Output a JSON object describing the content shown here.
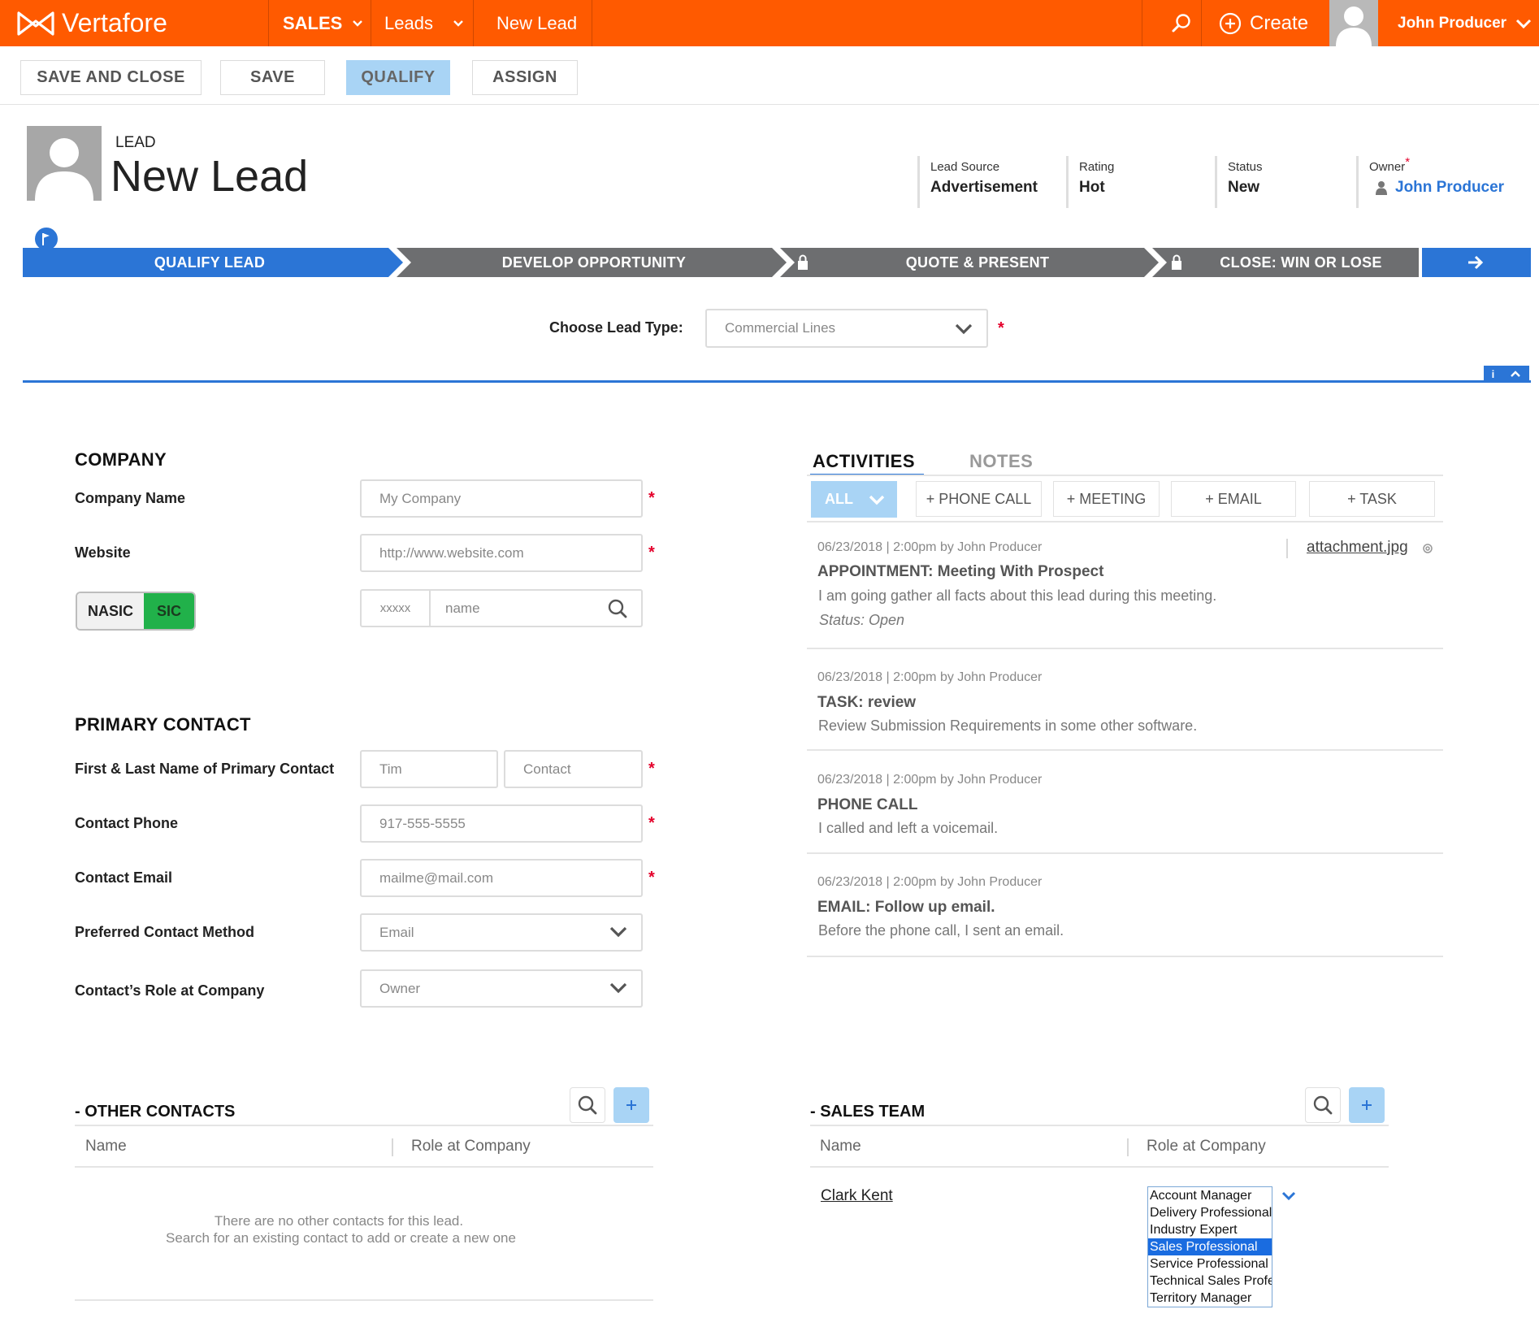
{
  "colors": {
    "brand": "#ff5a00",
    "accent": "#2b75d6",
    "required": "#e4002b",
    "sic_active": "#21b14a",
    "stage_inactive": "#6d6e70"
  },
  "topnav": {
    "brand": "Vertafore",
    "module": "SALES",
    "section": "Leads",
    "page": "New Lead",
    "create": "Create",
    "user": "John Producer"
  },
  "toolbar": {
    "save_close": "SAVE AND CLOSE",
    "save": "SAVE",
    "qualify": "QUALIFY",
    "assign": "ASSIGN"
  },
  "header": {
    "record_type": "LEAD",
    "title": "New Lead",
    "fields": {
      "lead_source": {
        "label": "Lead Source",
        "value": "Advertisement"
      },
      "rating": {
        "label": "Rating",
        "value": "Hot"
      },
      "status": {
        "label": "Status",
        "value": "New"
      },
      "owner": {
        "label": "Owner",
        "required": "*",
        "value": "John Producer"
      }
    }
  },
  "stages": [
    "QUALIFY LEAD",
    "DEVELOP OPPORTUNITY",
    "QUOTE & PRESENT",
    "CLOSE: WIN OR LOSE"
  ],
  "lead_type": {
    "label": "Choose Lead Type:",
    "value": "Commercial Lines",
    "required": "*"
  },
  "company": {
    "title": "COMPANY",
    "name_label": "Company Name",
    "name_placeholder": "My Company",
    "website_label": "Website",
    "website_placeholder": "http://www.website.com",
    "toggle": {
      "left": "NASIC",
      "right": "SIC",
      "active": "SIC"
    },
    "code_placeholder": "xxxxx",
    "code_name_placeholder": "name",
    "required": "*"
  },
  "primary_contact": {
    "title": "PRIMARY CONTACT",
    "name_label": "First & Last Name of Primary Contact",
    "first_placeholder": "Tim",
    "last_placeholder": "Contact",
    "phone_label": "Contact Phone",
    "phone_placeholder": "917-555-5555",
    "email_label": "Contact Email",
    "email_placeholder": "mailme@mail.com",
    "method_label": "Preferred Contact Method",
    "method_value": "Email",
    "role_label": "Contact’s Role at Company",
    "role_value": "Owner"
  },
  "activities": {
    "tabs": [
      "ACTIVITIES",
      "NOTES"
    ],
    "filter": "ALL",
    "buttons": [
      "+ PHONE CALL",
      "+ MEETING",
      "+ EMAIL",
      "+ TASK"
    ],
    "items": [
      {
        "meta": "06/23/2018 | 2:00pm by John Producer",
        "title": "APPOINTMENT: Meeting With Prospect",
        "desc": "I am going gather all facts about this lead during this meeting.",
        "status": "Status: Open",
        "attachment": "attachment.jpg"
      },
      {
        "meta": "06/23/2018 | 2:00pm by John Producer",
        "title": "TASK: review",
        "desc": "Review Submission Requirements in some other software."
      },
      {
        "meta": "06/23/2018 | 2:00pm by John Producer",
        "title": "PHONE CALL",
        "desc": "I called and left a voicemail."
      },
      {
        "meta": "06/23/2018 | 2:00pm by John Producer",
        "title": "EMAIL: Follow up email.",
        "desc": "Before the phone call, I sent an email."
      }
    ]
  },
  "other_contacts": {
    "title": "- OTHER CONTACTS",
    "columns": [
      "Name",
      "Role at Company"
    ],
    "empty_line1": "There are no other contacts for this lead.",
    "empty_line2": "Search for an existing contact to add or create a new one"
  },
  "sales_team": {
    "title": "- SALES TEAM",
    "columns": [
      "Name",
      "Role at Company"
    ],
    "member": "Clark Kent",
    "roles": [
      "Account Manager",
      "Delivery Professional",
      "Industry Expert",
      "Sales Professional",
      "Service Professional",
      "Technical Sales Profe",
      "Territory Manager"
    ],
    "selected_role": "Sales Professional"
  }
}
